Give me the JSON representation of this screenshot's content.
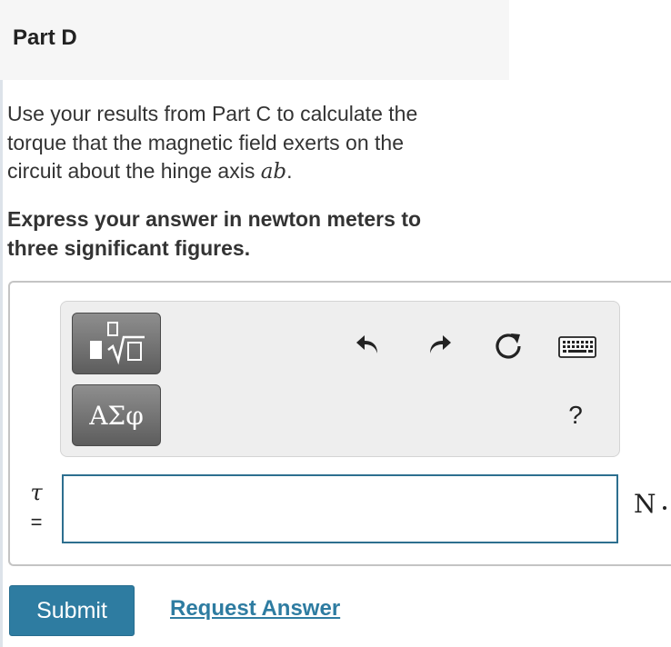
{
  "part": {
    "title": "Part D"
  },
  "question": {
    "text_line1": "Use your results from Part C to calculate the",
    "text_line2": "torque that the magnetic field exerts on the",
    "text_line3_before": "circuit about the hinge axis ",
    "axis_var": "ab",
    "text_line3_after": ".",
    "instruction_line1": "Express your answer in newton meters to",
    "instruction_line2": "three significant figures."
  },
  "toolbar": {
    "templates_icon": "fraction-sqrt-template-icon",
    "greek_label": "ΑΣφ",
    "undo_icon": "undo-arrow-icon",
    "redo_icon": "redo-arrow-icon",
    "reset_icon": "reset-icon",
    "keyboard_icon": "keyboard-icon",
    "help_label": "?"
  },
  "answer": {
    "variable": "τ",
    "equals": "=",
    "value": "",
    "unit": "N"
  },
  "actions": {
    "submit_label": "Submit",
    "request_label": "Request Answer"
  },
  "colors": {
    "accent": "#2e7ca1",
    "input_border": "#2d6f8f",
    "header_bg": "#f6f6f6",
    "toolbar_bg": "#eeeeee"
  }
}
